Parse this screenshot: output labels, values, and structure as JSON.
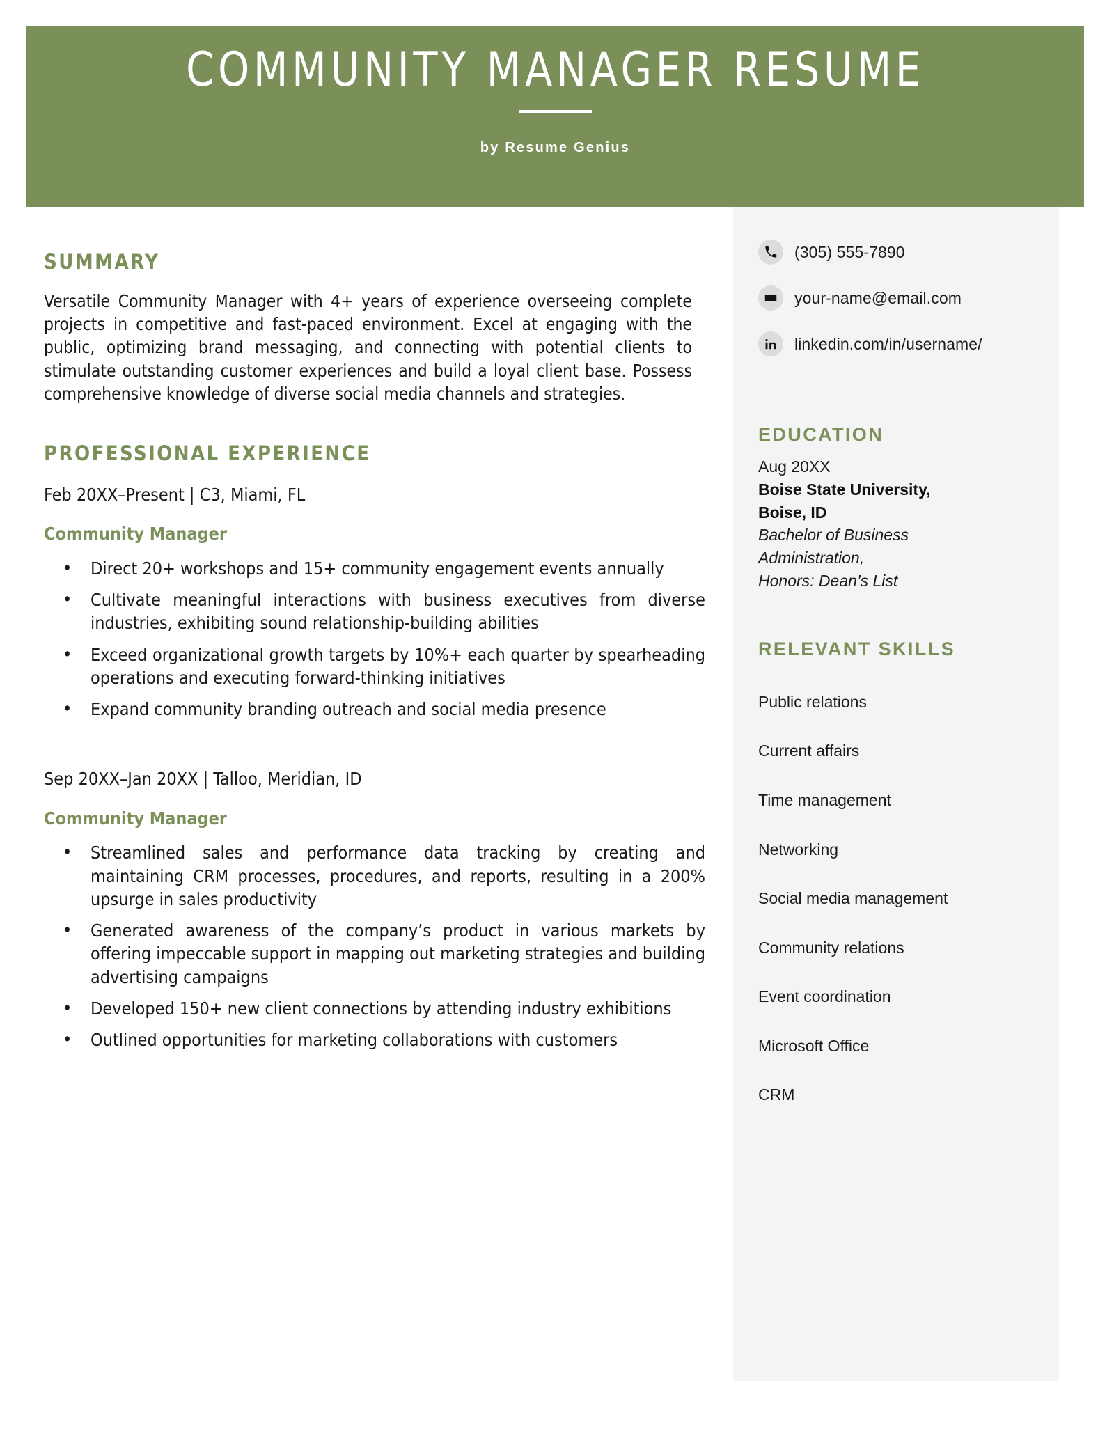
{
  "theme": {
    "accent_green": "#7b9059",
    "sidebar_bg": "#f4f4f5",
    "text": "#1a1a1a"
  },
  "header": {
    "title": "COMMUNITY MANAGER RESUME",
    "byline": "by Resume Genius"
  },
  "main": {
    "summary": {
      "heading": "SUMMARY",
      "text": "Versatile Community Manager with 4+ years of experience overseeing complete projects in competitive and fast-paced environment. Excel at engaging with the public, optimizing brand messaging, and connecting with potential clients to stimulate outstanding customer experiences and build a loyal client base. Possess comprehensive knowledge of diverse social media channels and strategies."
    },
    "experience": {
      "heading": "PROFESSIONAL EXPERIENCE",
      "jobs": [
        {
          "meta": "Feb 20XX–Present | C3, Miami, FL",
          "role": "Community Manager",
          "bullets": [
            "Direct 20+ workshops and 15+ community engagement events annually",
            "Cultivate meaningful interactions with business executives from diverse industries, exhibiting sound relationship-building abilities",
            "Exceed organizational growth targets by 10%+ each quarter by spearheading operations and executing forward-thinking initiatives",
            "Expand community branding outreach and social media presence"
          ]
        },
        {
          "meta": "Sep 20XX–Jan 20XX | Talloo, Meridian, ID",
          "role": "Community Manager",
          "bullets": [
            "Streamlined sales and performance data tracking by creating and maintaining CRM processes, procedures, and reports, resulting in a 200% upsurge in sales productivity",
            "Generated awareness of the company’s product in various markets by offering impeccable support in mapping out marketing strategies and building advertising campaigns",
            "Developed 150+ new client connections by attending industry exhibitions",
            "Outlined opportunities for marketing collaborations with customers"
          ]
        }
      ]
    }
  },
  "sidebar": {
    "contact": [
      {
        "icon": "phone-icon",
        "value": "(305) 555-7890"
      },
      {
        "icon": "email-icon",
        "value": "your-name@email.com"
      },
      {
        "icon": "linkedin-icon",
        "value": "linkedin.com/in/username/"
      }
    ],
    "education": {
      "heading": "EDUCATION",
      "date": "Aug 20XX",
      "school": "Boise State University,",
      "school_line2": "Boise, ID",
      "degree_line1": "Bachelor of Business",
      "degree_line2": "Administration,",
      "degree_line3": "Honors: Dean’s List"
    },
    "skills": {
      "heading": "RELEVANT SKILLS",
      "items": [
        "Public relations",
        "Current affairs",
        "Time management",
        "Networking",
        "Social media management",
        "Community relations",
        "Event coordination",
        "Microsoft Office",
        "CRM"
      ]
    }
  }
}
